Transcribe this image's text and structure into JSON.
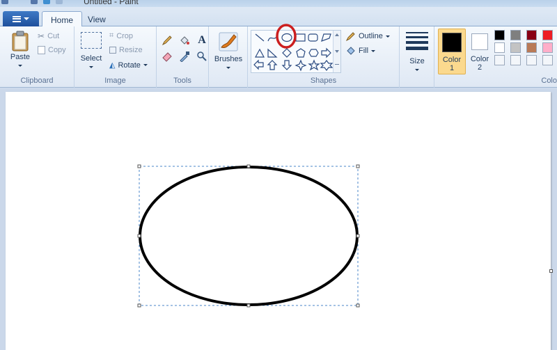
{
  "window": {
    "title": "Untitled - Paint"
  },
  "tabs": [
    {
      "label": "Home"
    },
    {
      "label": "View"
    }
  ],
  "clipboard": {
    "paste_label": "Paste",
    "cut_label": "Cut",
    "copy_label": "Copy",
    "group_label": "Clipboard"
  },
  "image": {
    "select_label": "Select",
    "crop_label": "Crop",
    "resize_label": "Resize",
    "rotate_label": "Rotate",
    "group_label": "Image"
  },
  "tools": {
    "group_label": "Tools"
  },
  "brushes": {
    "label": "Brushes"
  },
  "shapes": {
    "outline_label": "Outline",
    "fill_label": "Fill",
    "group_label": "Shapes"
  },
  "size": {
    "label": "Size"
  },
  "colors": {
    "color1_label": "Color",
    "color1_index": "1",
    "color2_label": "Color",
    "color2_index": "2",
    "group_label": "Colo",
    "color1_value": "#000000",
    "color2_value": "#ffffff",
    "palette": [
      "#000000",
      "#7f7f7f",
      "#880015",
      "#ed1c24",
      "#ffffff",
      "#c3c3c3",
      "#b97a57",
      "#ffaec9"
    ]
  },
  "annotation": {
    "color": "#cc1f1f"
  }
}
